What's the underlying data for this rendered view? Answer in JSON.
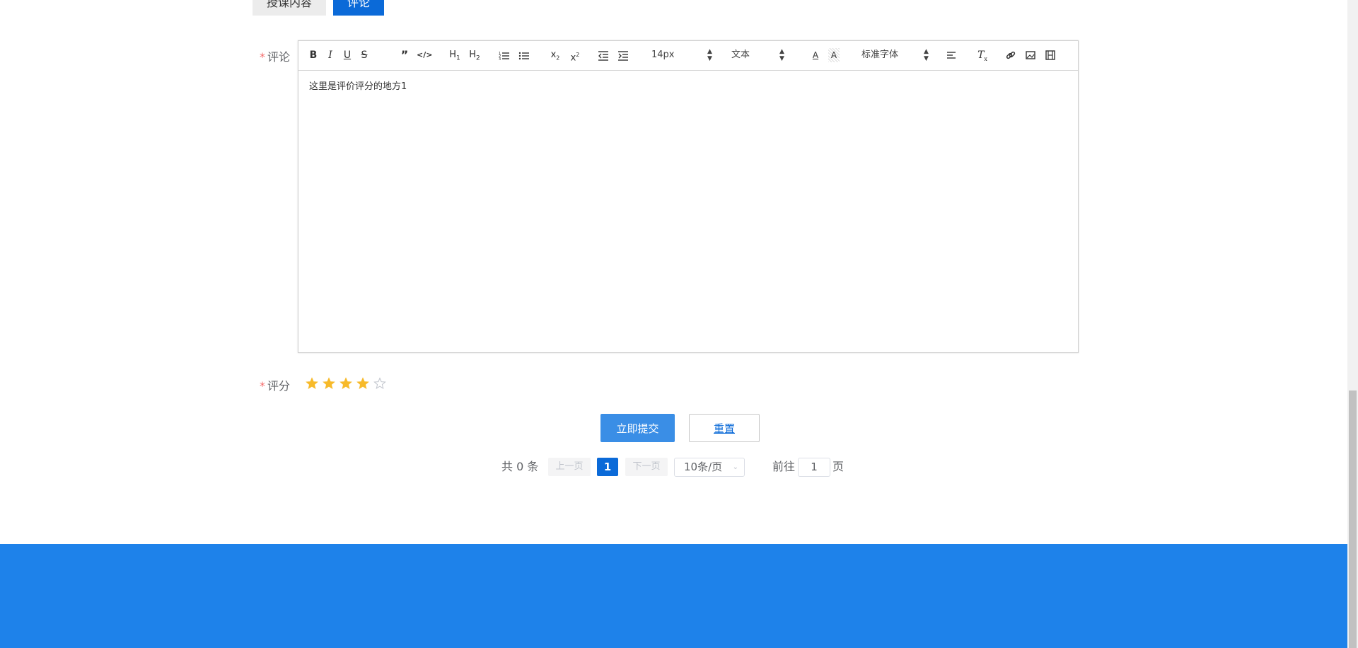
{
  "tabs": {
    "course_content": "授课内容",
    "comment": "评论"
  },
  "form": {
    "required_mark": "*",
    "comment_label": "评论",
    "rating_label": "评分",
    "rating_value": 4,
    "rating_max": 5
  },
  "editor": {
    "font_size": "14px",
    "block_format": "文本",
    "font_family": "标准字体",
    "content": "这里是评价评分的地方1"
  },
  "buttons": {
    "submit": "立即提交",
    "reset": "重置"
  },
  "pagination": {
    "total": "共 0 条",
    "prev": "上一页",
    "current_page": "1",
    "next": "下一页",
    "page_size": "10条/页",
    "goto_label": "前往",
    "goto_value": "1",
    "page_suffix": "页"
  },
  "colors": {
    "primary": "#0b6ad8",
    "submit": "#3a8ee6",
    "footer": "#1e82ea",
    "star_active": "#f7ba2a",
    "required": "#f56c6c"
  }
}
